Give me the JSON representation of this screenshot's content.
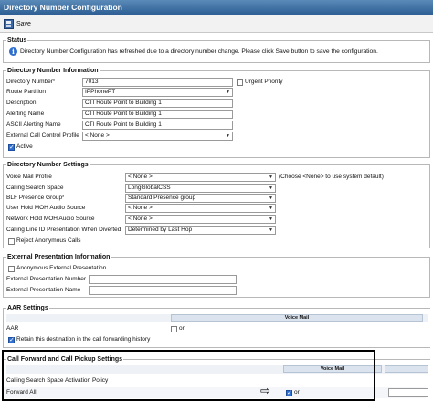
{
  "window": {
    "title": "Directory Number Configuration"
  },
  "toolbar": {
    "save_label": "Save"
  },
  "status": {
    "legend": "Status",
    "message": "Directory Number Configuration has refreshed due to a directory number change. Please click Save button to save the configuration."
  },
  "dn_info": {
    "legend": "Directory Number Information",
    "directory_number_label": "Directory Number",
    "required_mark": "*",
    "directory_number_value": "7013",
    "urgent_priority_label": "Urgent Priority",
    "route_partition_label": "Route Partition",
    "route_partition_value": "IPPhonePT",
    "description_label": "Description",
    "description_value": "CTI Route Point to Building 1",
    "alerting_name_label": "Alerting Name",
    "alerting_name_value": "CTI Route Point to Building 1",
    "ascii_alerting_name_label": "ASCII Alerting Name",
    "ascii_alerting_name_value": "CTI Route Point to Building 1",
    "ext_call_control_label": "External Call Control Profile",
    "ext_call_control_value": "< None >",
    "active_label": "Active"
  },
  "dn_settings": {
    "legend": "Directory Number Settings",
    "voice_mail_profile_label": "Voice Mail Profile",
    "voice_mail_profile_value": "< None >",
    "voice_mail_hint": "(Choose <None> to use system default)",
    "css_label": "Calling Search Space",
    "css_value": "LongGlobalCSS",
    "blf_label": "BLF Presence Group",
    "blf_required": "*",
    "blf_value": "Standard Presence group",
    "user_hold_label": "User Hold MOH Audio Source",
    "user_hold_value": "< None >",
    "network_hold_label": "Network Hold MOH Audio Source",
    "network_hold_value": "< None >",
    "calling_line_label": "Calling Line ID Presentation When Diverted",
    "calling_line_value": "Determined by Last Hop",
    "reject_anonymous_label": "Reject Anonymous Calls"
  },
  "ext_presentation": {
    "legend": "External Presentation Information",
    "anonymous_label": "Anonymous External Presentation",
    "ext_pres_number_label": "External Presentation Number",
    "ext_pres_name_label": "External Presentation Name"
  },
  "aar": {
    "legend": "AAR Settings",
    "voice_mail_header": "Voice Mail",
    "aar_label": "AAR",
    "or_text": "or",
    "retain_label": "Retain this destination in the call forwarding history"
  },
  "call_forward": {
    "legend": "Call Forward and Call Pickup Settings",
    "voice_mail_header": "Voice Mail",
    "css_activation_label": "Calling Search Space Activation Policy",
    "forward_all_label": "Forward All",
    "or_text": "or"
  }
}
